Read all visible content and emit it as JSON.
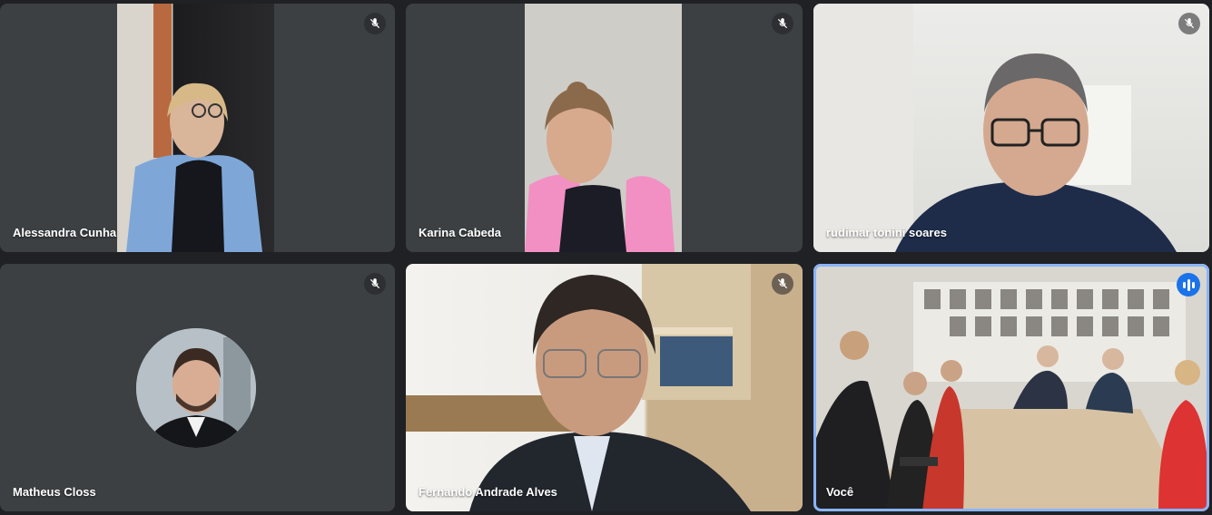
{
  "participants": [
    {
      "name": "Alessandra Cunha",
      "muted": true
    },
    {
      "name": "Karina Cabeda",
      "muted": true
    },
    {
      "name": "rudimar tonini soares",
      "muted": true
    },
    {
      "name": "Matheus Closs",
      "muted": true
    },
    {
      "name": "Fernando Andrade Alves",
      "muted": true
    },
    {
      "name": "Você",
      "muted": false,
      "speaking": true
    }
  ],
  "icons": {
    "mute": "mic-off-icon",
    "speaking": "audio-level-icon"
  },
  "colors": {
    "background": "#202124",
    "tile": "#3c4043",
    "active_border": "#8ab4f8",
    "speaking_badge": "#1a73e8"
  }
}
